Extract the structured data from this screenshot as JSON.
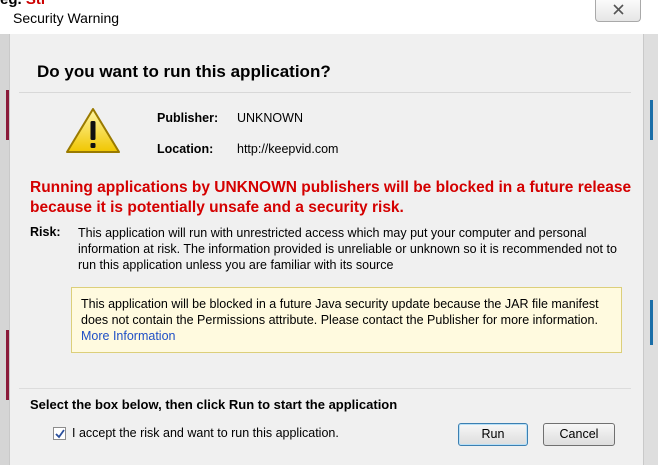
{
  "fragment": {
    "prefix": "eg.",
    "suffix": "Str"
  },
  "window": {
    "title": "Security Warning"
  },
  "dialog": {
    "heading": "Do you want to run this application?",
    "publisher_label": "Publisher:",
    "publisher_value": "UNKNOWN",
    "location_label": "Location:",
    "location_value": "http://keepvid.com",
    "warning": "Running applications by UNKNOWN publishers will be blocked in a future release because it is potentially unsafe and a security risk.",
    "risk_label": "Risk:",
    "risk_text": "This application will run with unrestricted access which may put your computer and personal information at risk. The information provided is unreliable or unknown so it is recommended not to run this application unless you are familiar with its source",
    "notice_text": "This application will be blocked in a future Java security update because the JAR file manifest does not contain the Permissions attribute. Please contact the Publisher for more information.",
    "notice_link": "More Information",
    "select_title": "Select the box below, then click Run to start the application",
    "checkbox_label": "I accept the risk and want to run this application.",
    "checkbox_checked": true,
    "run_label": "Run",
    "cancel_label": "Cancel"
  },
  "icons": {
    "close": "close-icon",
    "warning": "warning-triangle-icon",
    "check": "checkmark-icon"
  },
  "colors": {
    "warning_red": "#d40000",
    "notice_bg": "#fffadf",
    "link": "#1f4fc6",
    "panel": "#f0f0f0"
  }
}
